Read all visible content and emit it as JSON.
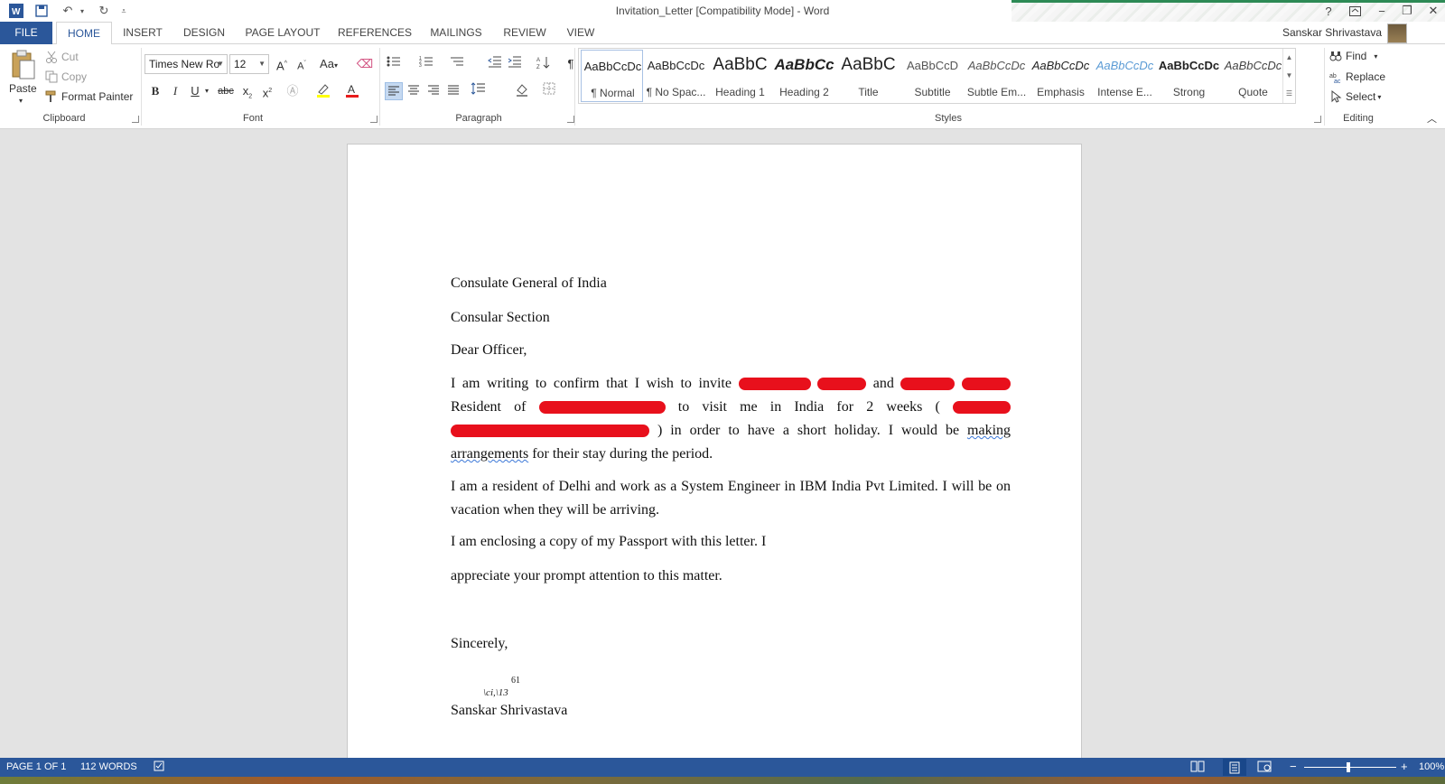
{
  "window": {
    "title": "Invitation_Letter [Compatibility Mode] - Word",
    "help_label": "?",
    "user_name": "Sanskar Shrivastava"
  },
  "tabs": [
    "FILE",
    "HOME",
    "INSERT",
    "DESIGN",
    "PAGE LAYOUT",
    "REFERENCES",
    "MAILINGS",
    "REVIEW",
    "VIEW"
  ],
  "ribbon": {
    "clipboard": {
      "paste": "Paste",
      "cut": "Cut",
      "copy": "Copy",
      "format_painter": "Format Painter",
      "label": "Clipboard"
    },
    "font": {
      "name": "Times New Ro",
      "size": "12",
      "grow": "A",
      "shrink": "A",
      "change_case": "Aa",
      "bold": "B",
      "italic": "I",
      "underline": "U",
      "strike": "abc",
      "subscript": "x",
      "superscript": "x",
      "label": "Font"
    },
    "paragraph": {
      "label": "Paragraph",
      "pilcrow": "¶"
    },
    "styles": {
      "label": "Styles",
      "items": [
        {
          "sample": "AaBbCcDc",
          "name": "¶ Normal"
        },
        {
          "sample": "AaBbCcDc",
          "name": "¶ No Spac..."
        },
        {
          "sample": "AaBbC",
          "name": "Heading 1"
        },
        {
          "sample": "AaBbCc",
          "name": "Heading 2"
        },
        {
          "sample": "AaBbC",
          "name": "Title"
        },
        {
          "sample": "AaBbCcD",
          "name": "Subtitle"
        },
        {
          "sample": "AaBbCcDc",
          "name": "Subtle Em..."
        },
        {
          "sample": "AaBbCcDc",
          "name": "Emphasis"
        },
        {
          "sample": "AaBbCcDc",
          "name": "Intense E..."
        },
        {
          "sample": "AaBbCcDc",
          "name": "Strong"
        },
        {
          "sample": "AaBbCcDc",
          "name": "Quote"
        }
      ]
    },
    "editing": {
      "find": "Find",
      "replace": "Replace",
      "select": "Select",
      "label": "Editing"
    }
  },
  "document": {
    "line1": "Consulate  General  of  India",
    "line2": "Consular Section",
    "salutation": "Dear Officer,",
    "p1": {
      "a": "I am writing to confirm that I wish to invite",
      "b": "and",
      "c": "Resident of",
      "d": "to visit me in India for 2 weeks (",
      "e": ") in order to have a short holiday. I would be",
      "f": "making arrangements",
      "g": "for their stay during the period."
    },
    "p2": "I am a resident of Delhi and work as a System Engineer in IBM India Pvt Limited. I will be on vacation when they will be arriving.",
    "p3": "I am enclosing a copy of my Passport with this letter. I",
    "p4": "appreciate your prompt attention to this matter.",
    "closing": "Sincerely,",
    "signature_mark": "\\ci,\\13",
    "signature_super": "61",
    "name": "Sanskar Shrivastava"
  },
  "status": {
    "page": "PAGE 1 OF 1",
    "words": "112 WORDS",
    "zoom": "100%"
  },
  "colors": {
    "accent": "#2b579a",
    "redaction": "#e8101c"
  }
}
